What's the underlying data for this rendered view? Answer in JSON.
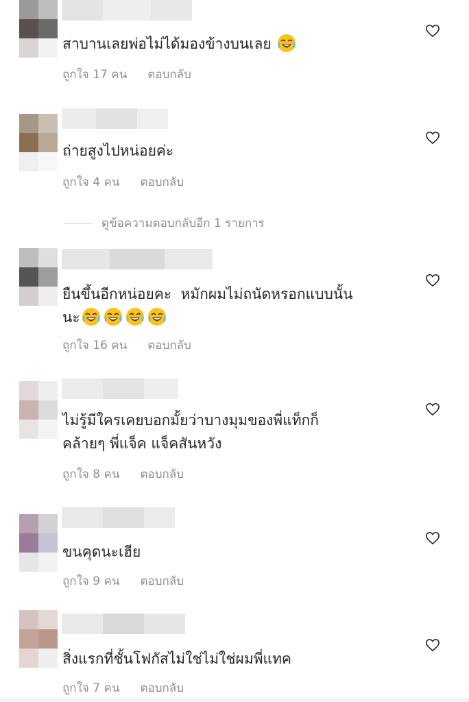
{
  "common": {
    "reply_label": "ตอบกลับ",
    "like_icon": "heart-outline-icon",
    "emoji_icon": "face-with-tears-of-joy-emoji"
  },
  "view_replies": {
    "label": "ดูข้อความตอบกลับอีก 1 รายการ"
  },
  "comments": [
    {
      "text": "สาบานเลยพ่อไม่ได้มองข้างบนเลย",
      "emoji_count": 1,
      "likes_label": "ถูกใจ 17 คน"
    },
    {
      "text": "ถ่ายสูงไปหน่อยค่ะ",
      "emoji_count": 0,
      "likes_label": "ถูกใจ 4 คน"
    },
    {
      "text": "ยืนขึ้นอีกหน่อยคะ  หมักผมไม่ถนัดหรอกแบบนั้น\nนะ",
      "emoji_count": 4,
      "likes_label": "ถูกใจ 16 คน"
    },
    {
      "text": "ไม่รู้มีใครเคยบอกมั้ยว่าบางมุมของพี่แท็กก็\nคล้ายๆ พี่แจ็ค แจ็คสันหวัง",
      "emoji_count": 0,
      "likes_label": "ถูกใจ 8 คน"
    },
    {
      "text": "ขนคุดนะเฮีย",
      "emoji_count": 0,
      "likes_label": "ถูกใจ 9 คน"
    },
    {
      "text": "สิ่งแรกที่ชั้นโฟกัสไม่ใช่ไม่ใช่ผมพี่แทค",
      "emoji_count": 0,
      "likes_label": "ถูกใจ 7 คน"
    }
  ]
}
